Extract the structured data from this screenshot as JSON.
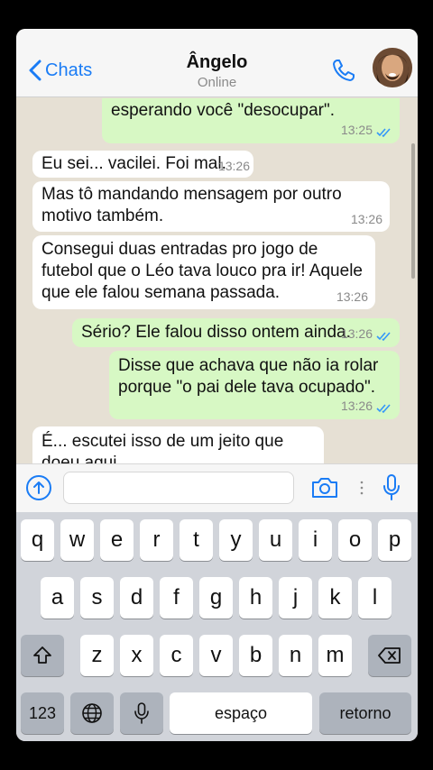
{
  "header": {
    "back_label": "Chats",
    "contact_name": "Ângelo",
    "status": "Online"
  },
  "messages": [
    {
      "dir": "out",
      "text": "esperando você \"desocupar\".",
      "time": "13:25"
    },
    {
      "dir": "in",
      "text": "Eu sei... vacilei. Foi mal.",
      "time": "13:26"
    },
    {
      "dir": "in",
      "text": "Mas tô mandando mensagem por outro motivo também.",
      "time": "13:26"
    },
    {
      "dir": "in",
      "text": "Consegui duas entradas pro jogo de futebol que o Léo tava louco pra ir! Aquele que ele falou semana passada.",
      "time": "13:26"
    },
    {
      "dir": "out",
      "text": "Sério? Ele falou disso ontem ainda.",
      "time": "13:26"
    },
    {
      "dir": "out",
      "text": "Disse que achava que não ia rolar porque \"o pai dele tava ocupado\".",
      "time": "13:26"
    },
    {
      "dir": "in",
      "text": "É... escutei isso de um jeito que doeu aqui.",
      "time": ""
    }
  ],
  "input": {
    "placeholder": ""
  },
  "keyboard": {
    "row1": [
      "q",
      "w",
      "e",
      "r",
      "t",
      "y",
      "u",
      "i",
      "o",
      "p"
    ],
    "row2": [
      "a",
      "s",
      "d",
      "f",
      "g",
      "h",
      "j",
      "k",
      "l"
    ],
    "row3": [
      "z",
      "x",
      "c",
      "v",
      "b",
      "n",
      "m"
    ],
    "numbers_label": "123",
    "space_label": "espaço",
    "return_label": "retorno"
  },
  "colors": {
    "accent": "#1a7cf5",
    "outgoing_bubble": "#d7f8c4",
    "incoming_bubble": "#ffffff",
    "chat_background": "#e6e0d4",
    "read_ticks": "#3497f9"
  },
  "icons": [
    "chevron-left-icon",
    "phone-icon",
    "plus-circle-icon",
    "camera-icon",
    "microphone-icon",
    "shift-icon",
    "backspace-icon",
    "globe-icon",
    "read-ticks-icon"
  ]
}
